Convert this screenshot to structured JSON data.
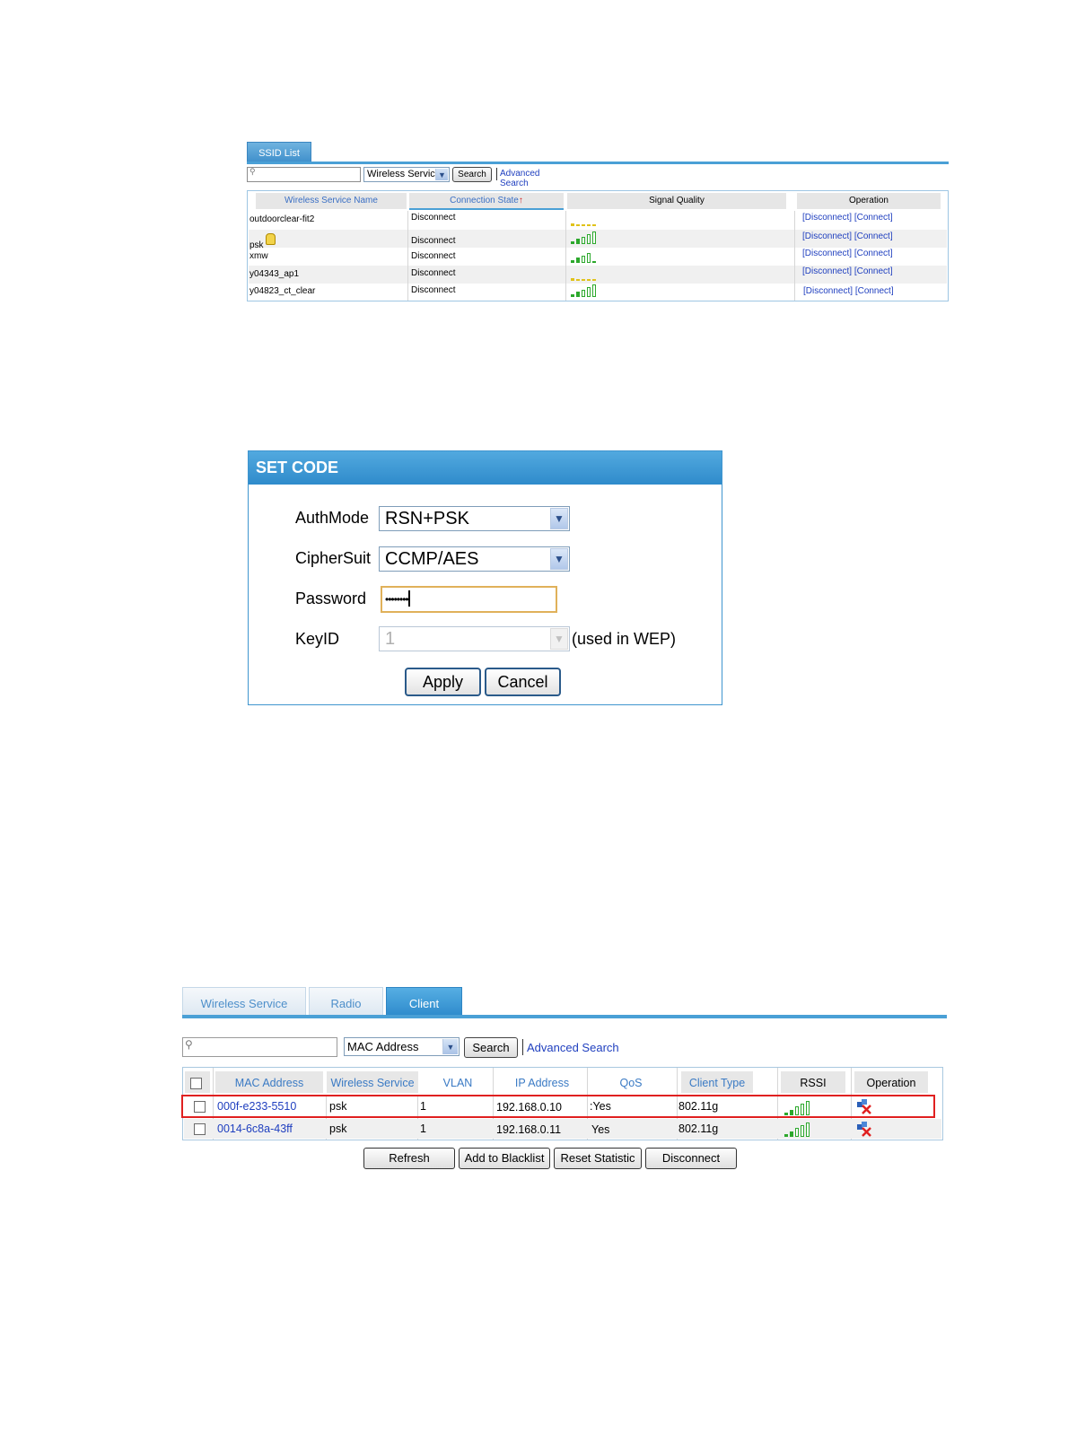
{
  "ssid_panel": {
    "tab": "SSID List",
    "search_select": "Wireless Service",
    "search_button": "Search",
    "advanced_search": "Advanced Search",
    "columns": [
      "Wireless Service Name",
      "Connection State",
      "Signal Quality",
      "Operation"
    ],
    "sort_marker": "↑",
    "rows": [
      {
        "name": "outdoorclear-fit2",
        "state": "Disconnect",
        "signal": 1,
        "locked": false
      },
      {
        "name": "psk",
        "state": "Disconnect",
        "signal": 5,
        "locked": true
      },
      {
        "name": "xmw",
        "state": "Disconnect",
        "signal": 4,
        "locked": false
      },
      {
        "name": "y04343_ap1",
        "state": "Disconnect",
        "signal": 1,
        "locked": false
      },
      {
        "name": "y04823_ct_clear",
        "state": "Disconnect",
        "signal": 5,
        "locked": false
      }
    ],
    "op_disconnect": "[Disconnect]",
    "op_connect": "[Connect]"
  },
  "set_code": {
    "title": "SET CODE",
    "authmode_label": "AuthMode",
    "authmode_value": "RSN+PSK",
    "cipher_label": "CipherSuit",
    "cipher_value": "CCMP/AES",
    "password_label": "Password",
    "password_value": "••••••••",
    "keyid_label": "KeyID",
    "keyid_value": "1",
    "keyid_note": "(used in WEP)",
    "apply": "Apply",
    "cancel": "Cancel"
  },
  "client_panel": {
    "tabs": [
      "Wireless Service",
      "Radio",
      "Client"
    ],
    "search_select": "MAC Address",
    "search_button": "Search",
    "advanced_search": "Advanced Search",
    "columns": [
      "MAC Address",
      "Wireless Service",
      "VLAN",
      "IP Address",
      "QoS",
      "Client Type",
      "RSSI",
      "Operation"
    ],
    "rows": [
      {
        "mac": "000f-e233-5510",
        "service": "psk",
        "vlan": "1",
        "ip": "192.168.0.10",
        "qos": ":Yes",
        "type": "802.11g",
        "rssi": 5,
        "highlighted": true
      },
      {
        "mac": "0014-6c8a-43ff",
        "service": "psk",
        "vlan": "1",
        "ip": "192.168.0.11",
        "qos": "Yes",
        "type": "802.11g",
        "rssi": 5,
        "highlighted": false
      }
    ],
    "buttons": [
      "Refresh",
      "Add to Blacklist",
      "Reset Statistic",
      "Disconnect"
    ]
  },
  "colors": {
    "accent_blue": "#3f95cf",
    "link_blue": "#1f3fbf",
    "signal_green": "#2ca82c",
    "signal_yellow": "#e0c21a",
    "highlight_red": "#e02020"
  }
}
